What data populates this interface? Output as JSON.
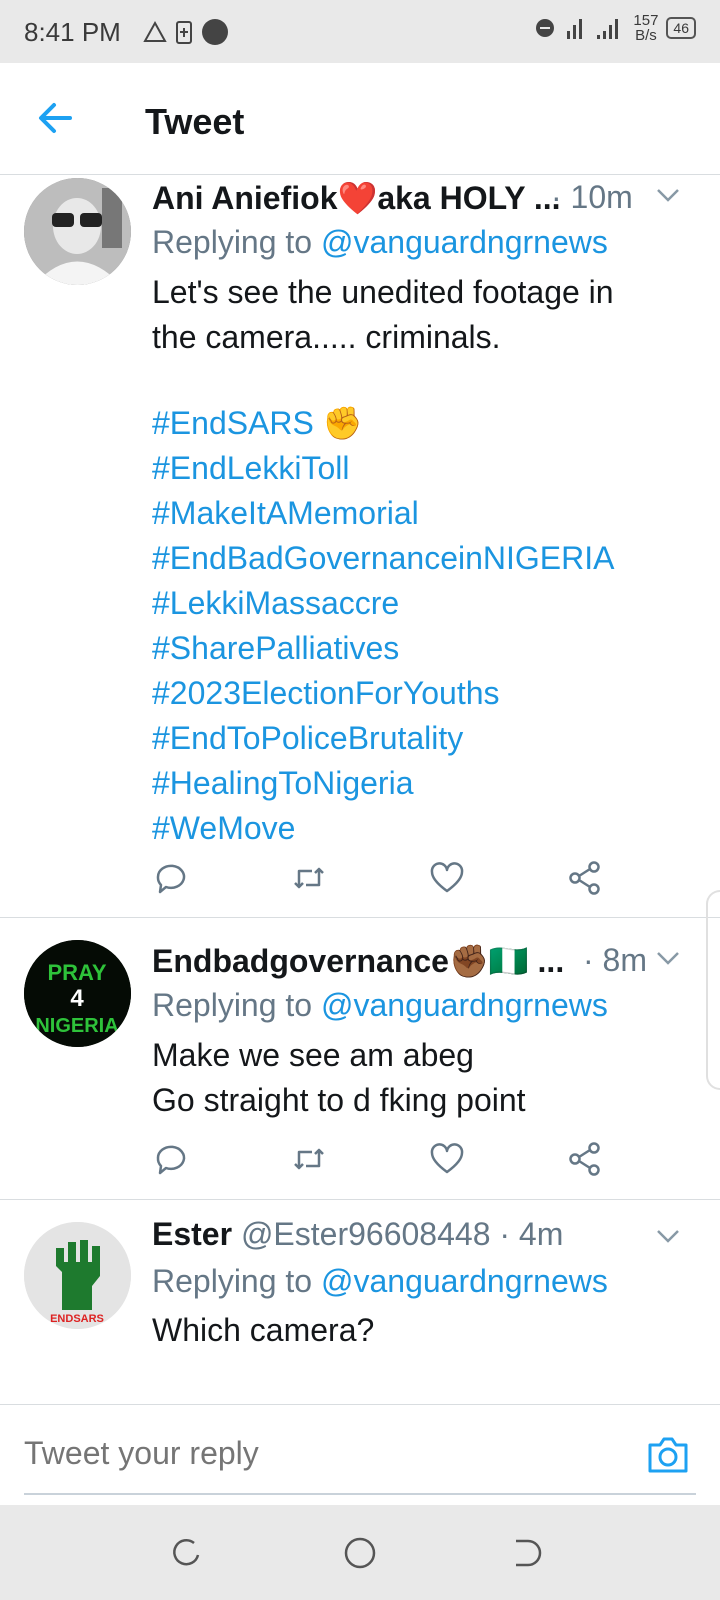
{
  "status_bar": {
    "time": "8:41 PM",
    "speed_value": "157",
    "speed_unit": "B/s",
    "battery": "46",
    "icons": [
      "alert-triangle-icon",
      "battery-saver-icon",
      "notification-dot-icon",
      "do-not-disturb-icon",
      "signal-icon"
    ]
  },
  "header": {
    "title": "Tweet",
    "back_icon": "arrow-left-icon",
    "accent_color": "#1da1f2"
  },
  "tweets": [
    {
      "name": "Ani Aniefiok❤️aka HOLY ...",
      "handle": "",
      "time": "· 10m",
      "replying_prefix": "Replying to",
      "replying_to": "@vanguardngrnews",
      "body_lines": [
        "Let's  see the unedited footage in",
        "the camera..... criminals."
      ],
      "hashtags": [
        "#EndSARS ✊",
        "#EndLekkiToll",
        "#MakeItAMemorial",
        "#EndBadGovernanceinNIGERIA",
        "#LekkiMassaccre",
        "#SharePalliatives",
        "#2023ElectionForYouths",
        "#EndToPoliceBrutality",
        "#HealingToNigeria",
        "#WeMove"
      ]
    },
    {
      "name": "Endbadgovernance✊🏾🇳🇬 ...",
      "time": "· 8m",
      "replying_prefix": "Replying to",
      "replying_to": "@vanguardngrnews",
      "body_lines": [
        "Make we see am abeg",
        "Go straight to d fking point"
      ],
      "avatar_text": [
        "PRAY",
        "4",
        "NIGERIA"
      ]
    },
    {
      "name": "Ester",
      "handle": "@Ester96608448",
      "time": "· 4m",
      "replying_prefix": "Replying to",
      "replying_to": "@vanguardngrnews",
      "body_lines": [
        "Which camera?"
      ],
      "avatar_text": [
        "ENDSARS"
      ]
    }
  ],
  "actions": [
    "reply-icon",
    "retweet-icon",
    "like-icon",
    "share-icon"
  ],
  "composer": {
    "placeholder": "Tweet your reply",
    "camera_icon": "camera-icon"
  },
  "nav_bar": [
    "recents-icon",
    "home-icon",
    "back-icon"
  ]
}
